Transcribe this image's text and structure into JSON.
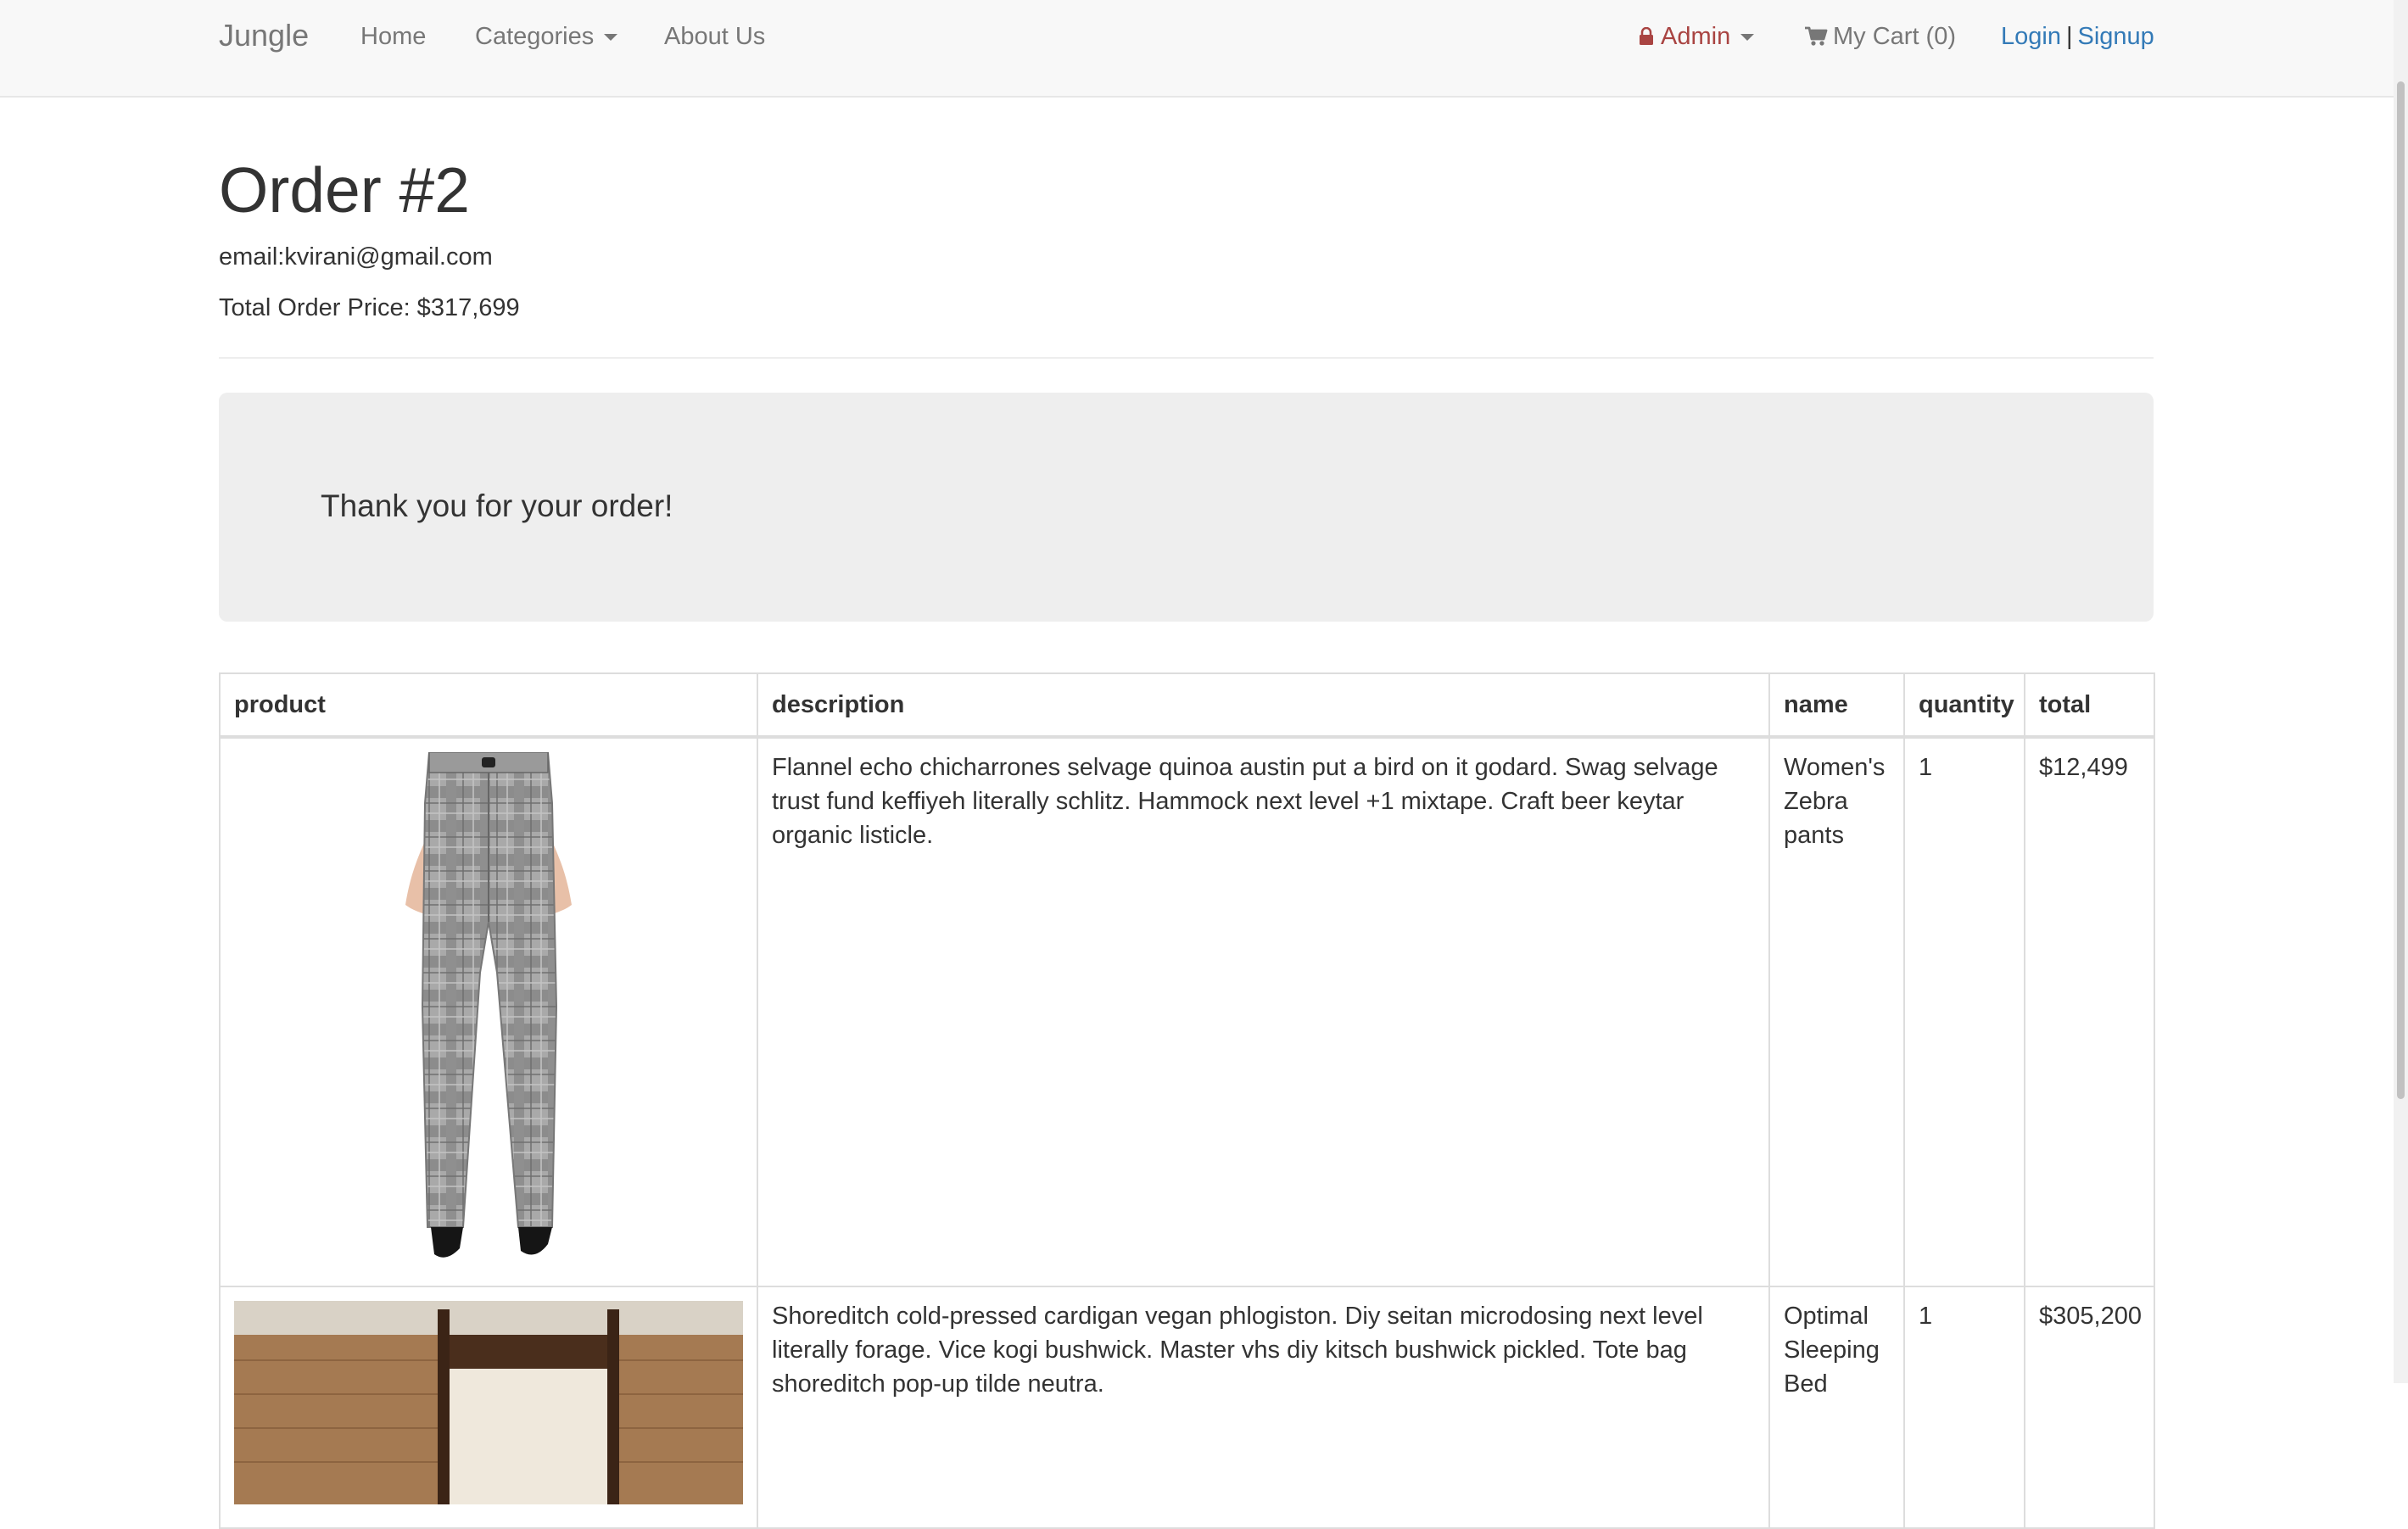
{
  "nav": {
    "brand": "Jungle",
    "home": "Home",
    "categories": "Categories",
    "about": "About Us",
    "admin": "Admin",
    "cart": "My Cart (0)",
    "login": "Login",
    "separator": "|",
    "signup": "Signup"
  },
  "order": {
    "title": "Order #2",
    "email": "email:kvirani@gmail.com",
    "total": "Total Order Price: $317,699",
    "thanks": "Thank you for your order!"
  },
  "table": {
    "headers": {
      "product": "product",
      "description": "description",
      "name": "name",
      "quantity": "quantity",
      "total": "total"
    },
    "rows": [
      {
        "description": "Flannel echo chicharrones selvage quinoa austin put a bird on it godard. Swag selvage trust fund keffiyeh literally schlitz. Hammock next level +1 mixtape. Craft beer keytar organic listicle.",
        "name": "Women's Zebra pants",
        "quantity": "1",
        "total": "$12,499"
      },
      {
        "description": "Shoreditch cold-pressed cardigan vegan phlogiston. Diy seitan microdosing next level literally forage. Vice kogi bushwick. Master vhs diy kitsch bushwick pickled. Tote bag shoreditch pop-up tilde neutra.",
        "name": "Optimal Sleeping Bed",
        "quantity": "1",
        "total": "$305,200"
      }
    ]
  },
  "colors": {
    "link": "#337ab7",
    "admin": "#a94442",
    "navbar_bg": "#f8f8f8",
    "jumbotron_bg": "#eeeeee"
  }
}
